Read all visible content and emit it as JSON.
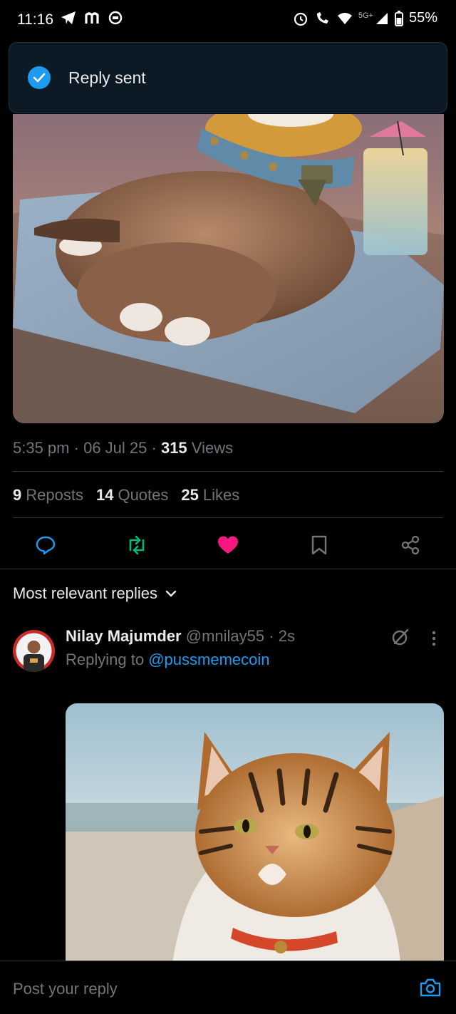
{
  "status_bar": {
    "time": "11:16",
    "network": "5G+",
    "battery": "55%"
  },
  "toast": {
    "message": "Reply sent"
  },
  "post": {
    "time": "5:35 pm",
    "date": "06 Jul 25",
    "views_count": "315",
    "views_label": "Views",
    "reposts_count": "9",
    "reposts_label": "Reposts",
    "quotes_count": "14",
    "quotes_label": "Quotes",
    "likes_count": "25",
    "likes_label": "Likes"
  },
  "replies": {
    "sort_label": "Most relevant replies",
    "items": [
      {
        "name": "Nilay Majumder",
        "handle": "@mnilay55",
        "time": "2s",
        "replying_prefix": "Replying to",
        "replying_to": "@pussmemecoin"
      }
    ]
  },
  "composer": {
    "placeholder": "Post your reply"
  },
  "colors": {
    "accent": "#1d9bf0",
    "like": "#f91880",
    "repost": "#00ba7c"
  }
}
